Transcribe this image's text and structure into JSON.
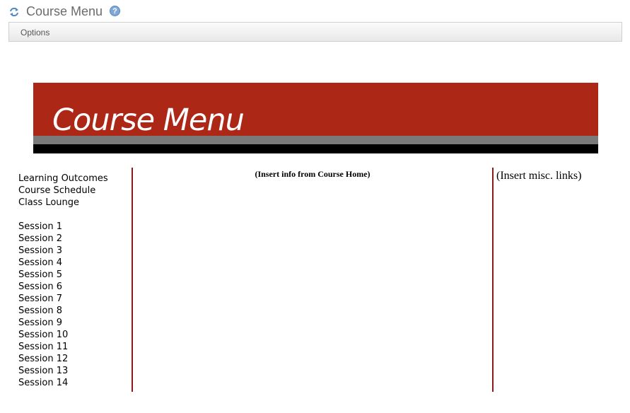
{
  "header": {
    "title": "Course Menu",
    "help_glyph": "?",
    "options_label": "Options"
  },
  "banner": {
    "title": "Course Menu",
    "background_color": "#ad2717"
  },
  "left_nav": {
    "top_links": [
      "Learning Outcomes",
      "Course Schedule",
      "Class Lounge"
    ],
    "sessions": [
      "Session 1",
      "Session 2",
      "Session 3",
      "Session 4",
      "Session 5",
      "Session 6",
      "Session 7",
      "Session 8",
      "Session 9",
      "Session 10",
      "Session 11",
      "Session 12",
      "Session 13",
      "Session 14"
    ]
  },
  "center": {
    "text": "(Insert info from Course Home)"
  },
  "right": {
    "text": "(Insert misc. links)"
  }
}
